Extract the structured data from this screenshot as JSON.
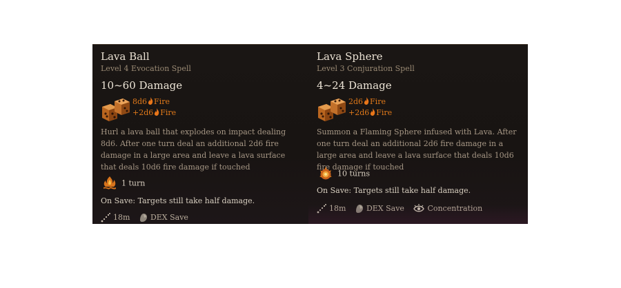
{
  "cards": [
    {
      "title": "Lava Ball",
      "subtitle": "Level 4 Evocation Spell",
      "damage": "10~60 Damage",
      "dice": [
        {
          "amount": "8d6",
          "type": "Fire"
        },
        {
          "amount": "+2d6",
          "type": "Fire"
        }
      ],
      "description": "Hurl a lava ball that explodes on impact dealing 8d6. After one turn deal an additional 2d6 fire damage in a large area and leave a lava surface that deals 10d6 fire damage if touched",
      "duration": "1 turn",
      "duration_icon": "fire-surface-icon",
      "on_save": "On Save: Targets still take half damage.",
      "footer": [
        {
          "icon": "range-icon",
          "label": "18m"
        },
        {
          "icon": "dex-save-icon",
          "label": "DEX Save"
        }
      ]
    },
    {
      "title": "Lava Sphere",
      "subtitle": "Level 3 Conjuration Spell",
      "damage": "4~24 Damage",
      "dice": [
        {
          "amount": "2d6",
          "type": "Fire"
        },
        {
          "amount": "+2d6",
          "type": "Fire"
        }
      ],
      "description": "Summon a Flaming Sphere infused with Lava. After one turn deal an additional 2d6 fire damage in a large area and leave a lava surface that deals 10d6 fire damage if touched",
      "duration": "10 turns",
      "duration_icon": "flaming-sphere-icon",
      "on_save": "On Save: Targets still take half damage.",
      "footer": [
        {
          "icon": "range-icon",
          "label": "18m"
        },
        {
          "icon": "dex-save-icon",
          "label": "DEX Save"
        },
        {
          "icon": "concentration-icon",
          "label": "Concentration"
        }
      ]
    }
  ],
  "colors": {
    "fire": "#e0791a",
    "panel_bg": "#1a1614",
    "title": "#e9e0d2",
    "subtitle": "#9a8a74",
    "body": "#a69785"
  }
}
